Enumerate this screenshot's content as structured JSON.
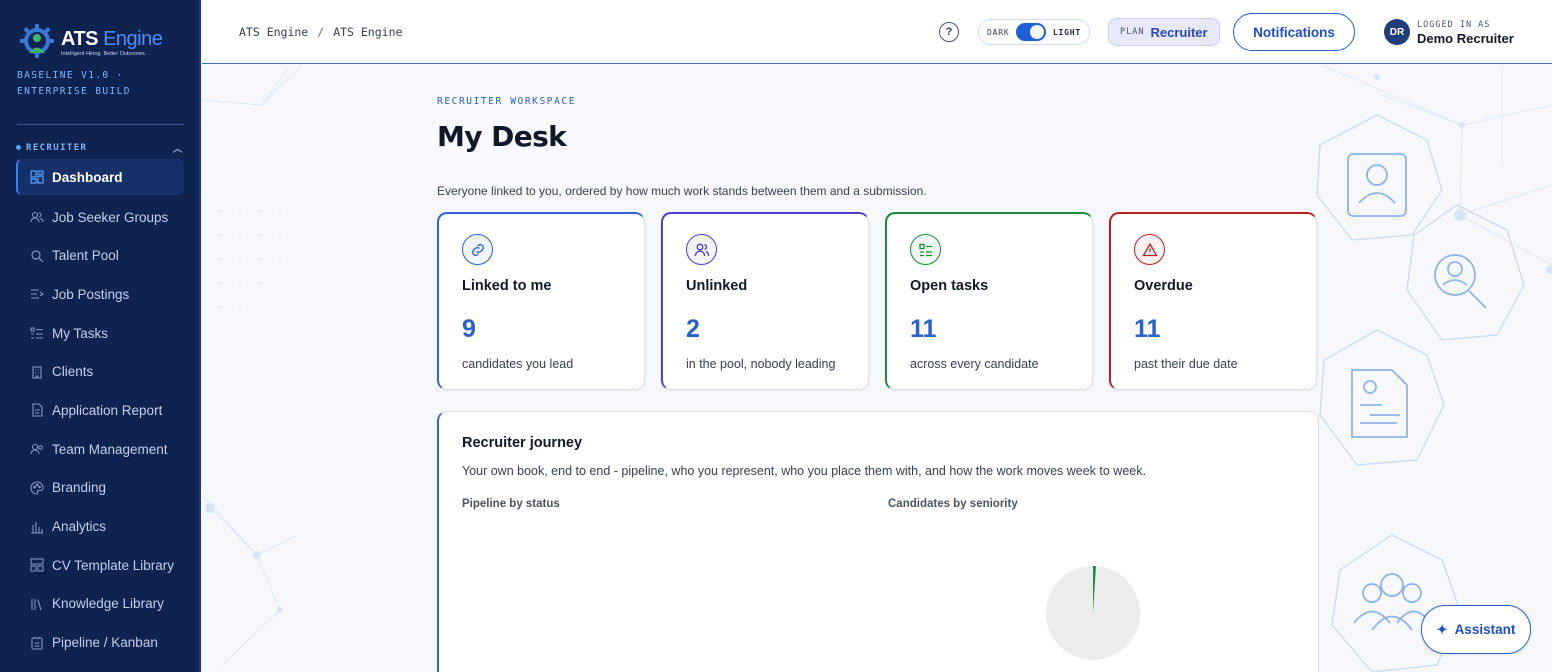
{
  "brand": {
    "name_part1": "ATS",
    "name_part2": "Engine",
    "tagline": "Intelligent Hiring. Better Outcomes.",
    "build": "BASELINE V1.0 · ENTERPRISE BUILD"
  },
  "sidebar": {
    "section": "RECRUITER",
    "items": [
      {
        "label": "Dashboard",
        "icon": "dashboard-icon",
        "active": true
      },
      {
        "label": "Job Seeker Groups",
        "icon": "users-icon"
      },
      {
        "label": "Talent Pool",
        "icon": "search-icon"
      },
      {
        "label": "Job Postings",
        "icon": "postings-icon"
      },
      {
        "label": "My Tasks",
        "icon": "tasks-icon"
      },
      {
        "label": "Clients",
        "icon": "building-icon"
      },
      {
        "label": "Application Report",
        "icon": "report-icon"
      },
      {
        "label": "Team Management",
        "icon": "team-icon"
      },
      {
        "label": "Branding",
        "icon": "palette-icon"
      },
      {
        "label": "Analytics",
        "icon": "bar-chart-icon"
      },
      {
        "label": "CV Template Library",
        "icon": "template-icon"
      },
      {
        "label": "Knowledge Library",
        "icon": "library-icon"
      },
      {
        "label": "Pipeline / Kanban",
        "icon": "kanban-icon"
      }
    ]
  },
  "header": {
    "breadcrumb": [
      "ATS Engine",
      "ATS Engine"
    ],
    "breadcrumb_sep": "/",
    "theme_dark": "DARK",
    "theme_light": "LIGHT",
    "plan_label": "PLAN",
    "plan_value": "Recruiter",
    "notifications": "Notifications",
    "avatar_initials": "DR",
    "logged_in_as": "LOGGED IN AS",
    "user_name": "Demo Recruiter"
  },
  "page": {
    "eyebrow": "RECRUITER WORKSPACE",
    "title": "My Desk",
    "subtitle": "Everyone linked to you, ordered by how much work stands between them and a submission."
  },
  "cards": [
    {
      "title": "Linked to me",
      "value": "9",
      "desc": "candidates you lead",
      "color": "#2f63d6",
      "icon": "link-icon"
    },
    {
      "title": "Unlinked",
      "value": "2",
      "desc": "in the pool, nobody leading",
      "color": "#4d3fcf",
      "icon": "users-icon"
    },
    {
      "title": "Open tasks",
      "value": "11",
      "desc": "across every candidate",
      "color": "#1c8a3a",
      "icon": "checklist-icon"
    },
    {
      "title": "Overdue",
      "value": "11",
      "desc": "past their due date",
      "color": "#b42323",
      "icon": "warning-icon"
    }
  ],
  "journey": {
    "title": "Recruiter journey",
    "desc": "Your own book, end to end - pipeline, who you represent, who you place them with, and how the work moves week to week.",
    "chart1_label": "Pipeline by status",
    "chart2_label": "Candidates by seniority"
  },
  "chart_data": {
    "type": "pie",
    "slices": [
      {
        "value": 99,
        "color": "#ececec"
      },
      {
        "value": 1,
        "color": "#1c8a3a"
      }
    ]
  },
  "assistant": "Assistant",
  "colors": {
    "sidebar_bg": "#0f2350",
    "accent": "#2b5fcc",
    "green": "#1c8a3a",
    "red": "#b42323",
    "purple": "#4d3fcf"
  }
}
